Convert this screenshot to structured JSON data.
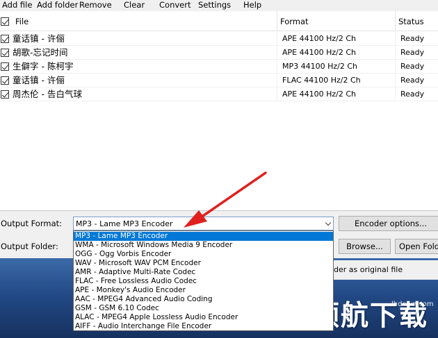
{
  "menu": [
    "Add file",
    "Add folder",
    "Remove",
    "Clear",
    "Convert",
    "Settings",
    "Help"
  ],
  "list": {
    "columns": {
      "file": "File",
      "format": "Format",
      "status": "Status"
    },
    "rows": [
      {
        "name": "童话镇 - 许俪",
        "format": "APE 44100 Hz/2 Ch",
        "status": "Ready"
      },
      {
        "name": "胡歌-忘记时间",
        "format": "APE 44100 Hz/2 Ch",
        "status": "Ready"
      },
      {
        "name": "生僻字 - 陈柯宇",
        "format": "MP3 44100 Hz/2 Ch",
        "status": "Ready"
      },
      {
        "name": "童话镇 - 许俪",
        "format": "FLAC 44100 Hz/2 Ch",
        "status": "Ready"
      },
      {
        "name": "周杰伦 - 告白气球",
        "format": "APE 44100 Hz/2 Ch",
        "status": "Ready"
      }
    ]
  },
  "output": {
    "format_label": "Output Format:",
    "folder_label": "Output Folder:",
    "selected_format": "MP3 - Lame MP3 Encoder",
    "encoder_options_label": "Encoder options...",
    "browse_label": "Browse...",
    "open_folder_label": "Open Folder",
    "same_folder_text": "der as original file"
  },
  "dropdown_options": [
    "MP3 - Lame MP3 Encoder",
    "WMA - Microsoft Windows Media 9 Encoder",
    "OGG - Ogg Vorbis Encoder",
    "WAV - Microsoft WAV PCM Encoder",
    "AMR - Adaptive Multi-Rate Codec",
    "FLAC - Free Lossless Audio Codec",
    "APE - Monkey's Audio Encoder",
    "AAC - MPEG4 Advanced Audio Coding",
    "GSM - GSM 6.10 Codec",
    "ALAC - MPEG4 Apple Lossless Audio Encoder",
    "AIFF - Audio Interchange File Encoder"
  ],
  "watermark": {
    "site": "lhdown.com",
    "logo": "领航下载"
  },
  "colors": {
    "selection": "#0078d7",
    "arrow": "#e0201e",
    "band": "#224a86"
  },
  "icons": {
    "checkbox": "check-icon",
    "combo": "chevron-down-icon",
    "annotation": "red-arrow-icon"
  }
}
